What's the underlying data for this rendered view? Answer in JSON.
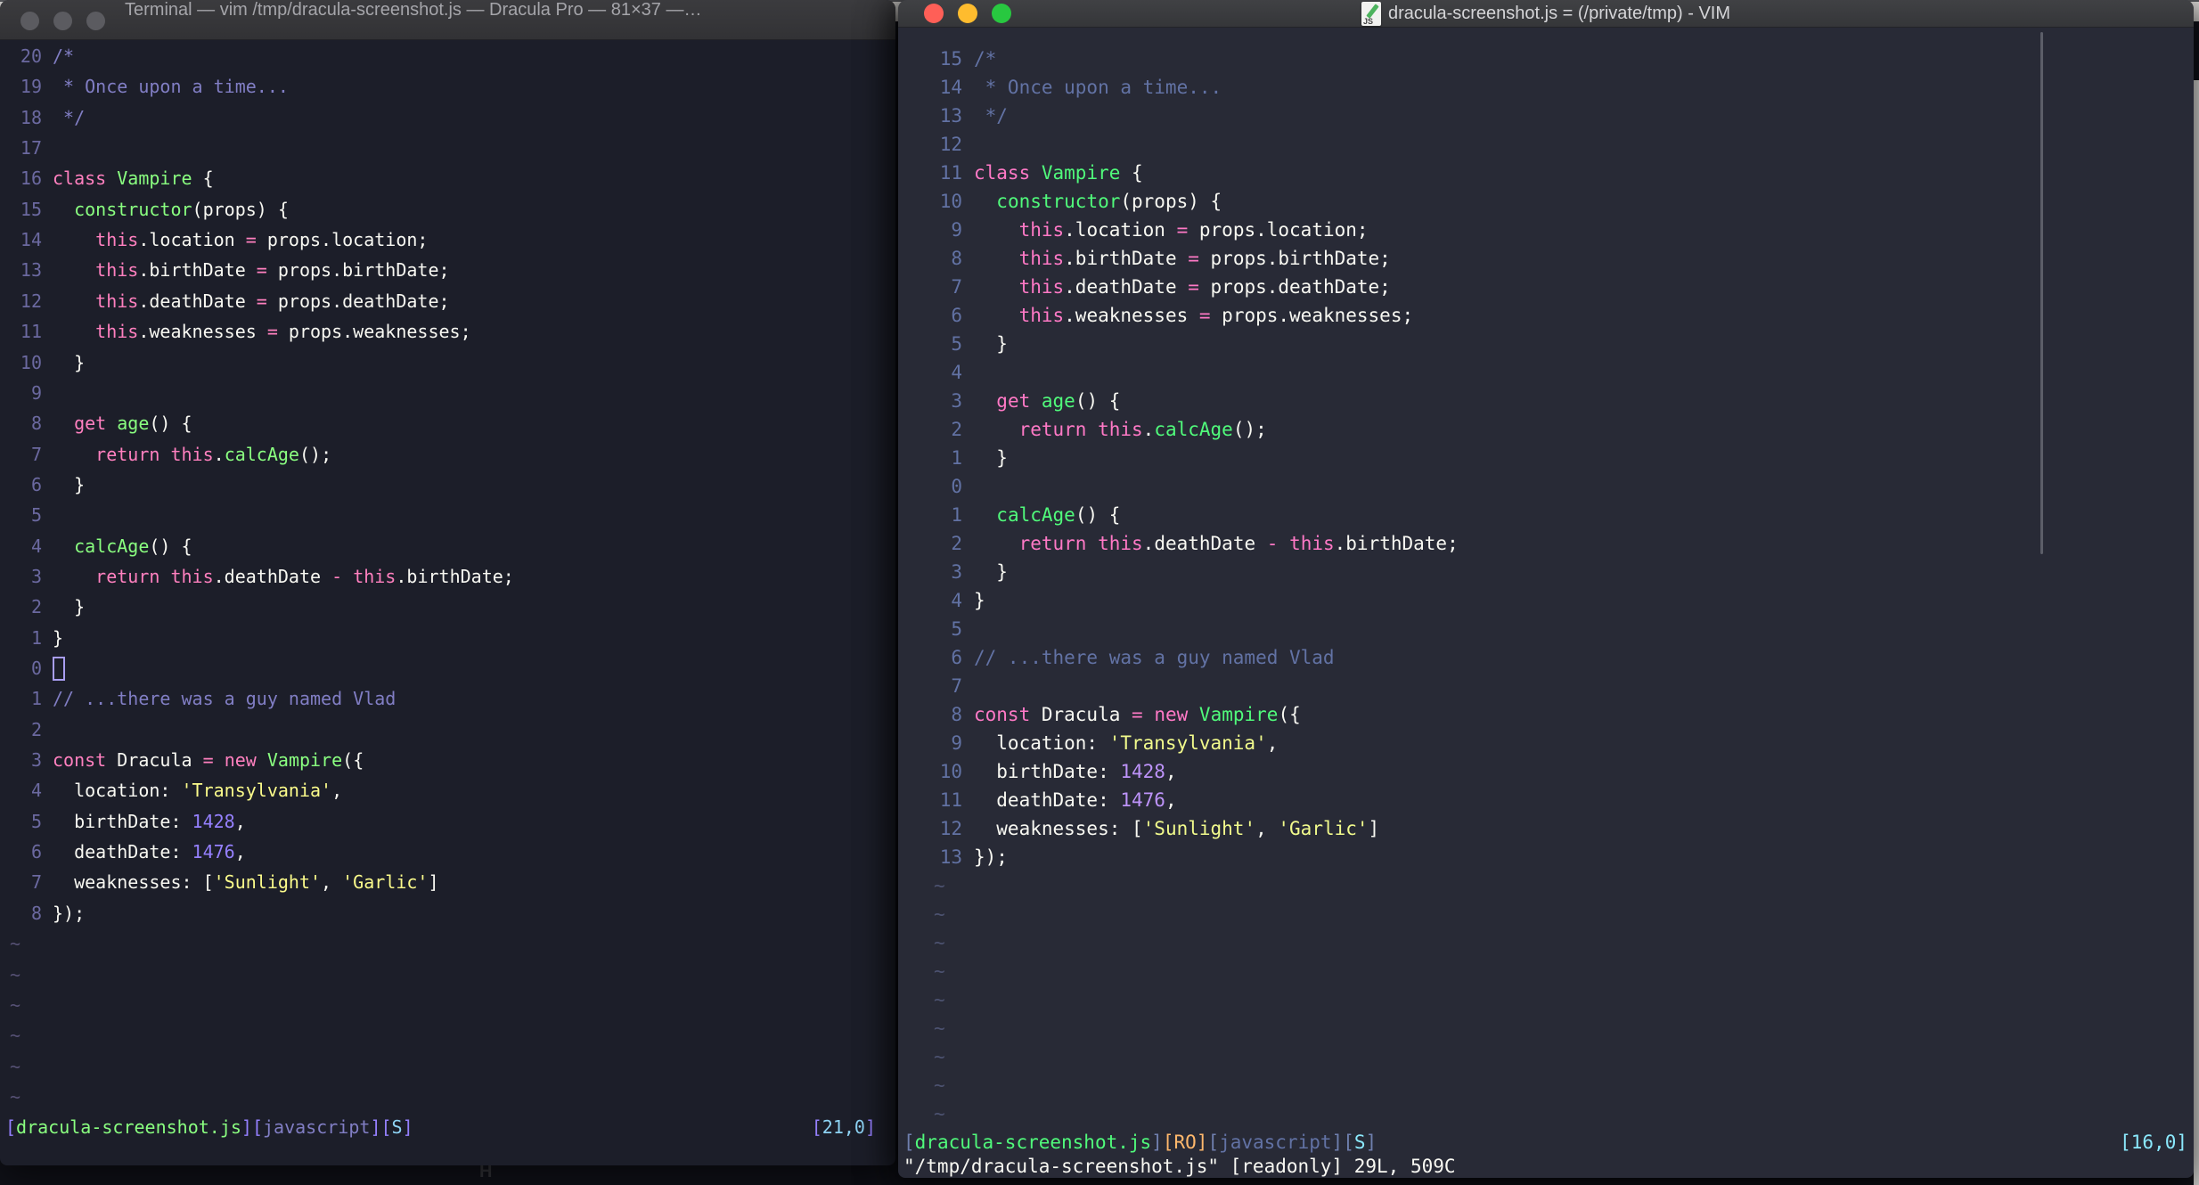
{
  "macos_colors": {
    "red": "#ff5f57",
    "yellow": "#febc2e",
    "green": "#28c840",
    "inactive": "#5b5b60"
  },
  "palette_left": {
    "bg": "#1c1e29",
    "fg": "#f8f8f2",
    "comment": "#817ec4",
    "linenr": "#6b69a0",
    "pink": "#ff80bf",
    "green": "#8aff80",
    "yellow": "#fbfb8b",
    "purple": "#9580ff",
    "cyan": "#8ed3f4",
    "sbr": "#9580ff",
    "tilde": "#565175",
    "cursor": "#a89df0"
  },
  "palette_right": {
    "bg": "#282a36",
    "fg": "#f8f8f2",
    "comment": "#6272a4",
    "linenr": "#6272a4",
    "pink": "#ff79c6",
    "green": "#50fa7b",
    "yellow": "#f1fa8c",
    "purple": "#bd93f9",
    "cyan": "#8be9fd",
    "orange": "#ffb86c",
    "sbr": "#6f7fae",
    "tilde": "#4c5270",
    "cursor": "#f8f8f2"
  },
  "window_left": {
    "title": "Terminal — vim /tmp/dracula-screenshot.js — Dracula Pro — 81×37 —…",
    "cursor_row": 21,
    "tilde_count": 6,
    "line_numbers": [
      "20",
      "19",
      "18",
      "17",
      "16",
      "15",
      "14",
      "13",
      "12",
      "11",
      "10",
      "9",
      "8",
      "7",
      "6",
      "5",
      "4",
      "3",
      "2",
      "1",
      "0",
      "1",
      "2",
      "3",
      "4",
      "5",
      "6",
      "7",
      "8"
    ],
    "status_segments": [
      [
        "[",
        "sbr"
      ],
      [
        "dracula-screenshot.js",
        "green"
      ],
      [
        "]",
        "sbr"
      ],
      [
        "[",
        "sbr"
      ],
      [
        "javascript",
        "comment"
      ],
      [
        "]",
        "sbr"
      ],
      [
        "[",
        "sbr"
      ],
      [
        "S",
        "cyan"
      ],
      [
        "]",
        "sbr"
      ]
    ],
    "ruler_segments": [
      [
        "[",
        "sbr"
      ],
      [
        "21,0",
        "cyan"
      ],
      [
        "]",
        "sbr"
      ]
    ]
  },
  "window_right": {
    "title": "dracula-screenshot.js = (/private/tmp) - VIM",
    "doc_icon_label": "JS",
    "cursor_row": 0,
    "tilde_count": 9,
    "line_numbers": [
      "15",
      "14",
      "13",
      "12",
      "11",
      "10",
      "9",
      "8",
      "7",
      "6",
      "5",
      "4",
      "3",
      "2",
      "1",
      "0",
      "1",
      "2",
      "3",
      "4",
      "5",
      "6",
      "7",
      "8",
      "9",
      "10",
      "11",
      "12",
      "13"
    ],
    "status_segments": [
      [
        "[",
        "sbr"
      ],
      [
        "dracula-screenshot.js",
        "green"
      ],
      [
        "]",
        "sbr"
      ],
      [
        "[",
        "orange"
      ],
      [
        "RO",
        "orange"
      ],
      [
        "]",
        "orange"
      ],
      [
        "[",
        "sbr"
      ],
      [
        "javascript",
        "comment"
      ],
      [
        "]",
        "sbr"
      ],
      [
        "[",
        "sbr"
      ],
      [
        "S",
        "cyan"
      ],
      [
        "]",
        "sbr"
      ]
    ],
    "ruler_segments": [
      [
        "[",
        "cyan"
      ],
      [
        "16,0",
        "cyan"
      ],
      [
        "]",
        "cyan"
      ]
    ],
    "command_line": "\"/tmp/dracula-screenshot.js\" [readonly] 29L, 509C"
  },
  "code_lines": [
    [
      [
        "/*",
        "comment"
      ]
    ],
    [
      [
        " * Once upon a time...",
        "comment"
      ]
    ],
    [
      [
        " */",
        "comment"
      ]
    ],
    [],
    [
      [
        "class",
        "pink"
      ],
      [
        " ",
        "fg"
      ],
      [
        "Vampire",
        "green"
      ],
      [
        " {",
        "fg"
      ]
    ],
    [
      [
        "  ",
        "fg"
      ],
      [
        "constructor",
        "green"
      ],
      [
        "(props) {",
        "fg"
      ]
    ],
    [
      [
        "    ",
        "fg"
      ],
      [
        "this",
        "pink"
      ],
      [
        ".location ",
        "fg"
      ],
      [
        "=",
        "pink"
      ],
      [
        " props.location;",
        "fg"
      ]
    ],
    [
      [
        "    ",
        "fg"
      ],
      [
        "this",
        "pink"
      ],
      [
        ".birthDate ",
        "fg"
      ],
      [
        "=",
        "pink"
      ],
      [
        " props.birthDate;",
        "fg"
      ]
    ],
    [
      [
        "    ",
        "fg"
      ],
      [
        "this",
        "pink"
      ],
      [
        ".deathDate ",
        "fg"
      ],
      [
        "=",
        "pink"
      ],
      [
        " props.deathDate;",
        "fg"
      ]
    ],
    [
      [
        "    ",
        "fg"
      ],
      [
        "this",
        "pink"
      ],
      [
        ".weaknesses ",
        "fg"
      ],
      [
        "=",
        "pink"
      ],
      [
        " props.weaknesses;",
        "fg"
      ]
    ],
    [
      [
        "  }",
        "fg"
      ]
    ],
    [],
    [
      [
        "  ",
        "fg"
      ],
      [
        "get",
        "pink"
      ],
      [
        " ",
        "fg"
      ],
      [
        "age",
        "green"
      ],
      [
        "() {",
        "fg"
      ]
    ],
    [
      [
        "    ",
        "fg"
      ],
      [
        "return",
        "pink"
      ],
      [
        " ",
        "fg"
      ],
      [
        "this",
        "pink"
      ],
      [
        ".",
        "fg"
      ],
      [
        "calcAge",
        "green"
      ],
      [
        "();",
        "fg"
      ]
    ],
    [
      [
        "  }",
        "fg"
      ]
    ],
    [],
    [
      [
        "  ",
        "fg"
      ],
      [
        "calcAge",
        "green"
      ],
      [
        "() {",
        "fg"
      ]
    ],
    [
      [
        "    ",
        "fg"
      ],
      [
        "return",
        "pink"
      ],
      [
        " ",
        "fg"
      ],
      [
        "this",
        "pink"
      ],
      [
        ".deathDate ",
        "fg"
      ],
      [
        "-",
        "pink"
      ],
      [
        " ",
        "fg"
      ],
      [
        "this",
        "pink"
      ],
      [
        ".birthDate;",
        "fg"
      ]
    ],
    [
      [
        "  }",
        "fg"
      ]
    ],
    [
      [
        "}",
        "fg"
      ]
    ],
    [],
    [
      [
        "// ...there was a guy named Vlad",
        "comment"
      ]
    ],
    [],
    [
      [
        "const",
        "pink"
      ],
      [
        " Dracula ",
        "fg"
      ],
      [
        "=",
        "pink"
      ],
      [
        " ",
        "fg"
      ],
      [
        "new",
        "pink"
      ],
      [
        " ",
        "fg"
      ],
      [
        "Vampire",
        "green"
      ],
      [
        "({",
        "fg"
      ]
    ],
    [
      [
        "  location: ",
        "fg"
      ],
      [
        "'Transylvania'",
        "yellow"
      ],
      [
        ",",
        "fg"
      ]
    ],
    [
      [
        "  birthDate: ",
        "fg"
      ],
      [
        "1428",
        "purple"
      ],
      [
        ",",
        "fg"
      ]
    ],
    [
      [
        "  deathDate: ",
        "fg"
      ],
      [
        "1476",
        "purple"
      ],
      [
        ",",
        "fg"
      ]
    ],
    [
      [
        "  weaknesses: [",
        "fg"
      ],
      [
        "'Sunlight'",
        "yellow"
      ],
      [
        ", ",
        "fg"
      ],
      [
        "'Garlic'",
        "yellow"
      ],
      [
        "]",
        "fg"
      ]
    ],
    [
      [
        "});",
        "fg"
      ]
    ]
  ],
  "artifacts": {
    "background_glyph": "H"
  }
}
